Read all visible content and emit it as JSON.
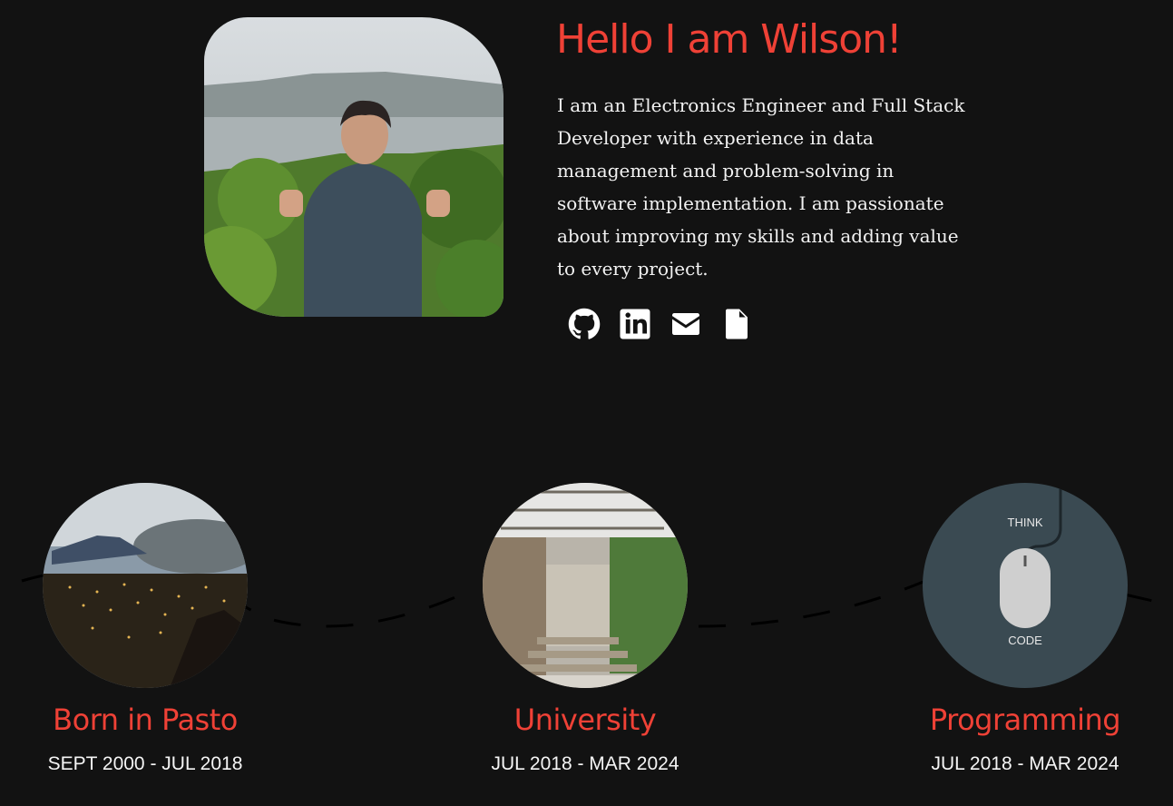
{
  "hero": {
    "title": "Hello I am Wilson!",
    "bio": "I am an Electronics Engineer and Full Stack Developer with experience in data management and problem-solving in software implementation. I am passionate about improving my skills and adding value to every project."
  },
  "social": [
    {
      "icon": "github-icon"
    },
    {
      "icon": "linkedin-icon"
    },
    {
      "icon": "envelope-icon"
    },
    {
      "icon": "document-icon"
    }
  ],
  "timeline": [
    {
      "title": "Born in Pasto",
      "date": "SEPT 2000 - JUL 2018"
    },
    {
      "title": "University",
      "date": "JUL 2018 - MAR 2024"
    },
    {
      "title": "Programming",
      "date": "JUL 2018 - MAR 2024",
      "image_text": {
        "top": "THINK",
        "bottom": "CODE"
      }
    }
  ],
  "colors": {
    "accent": "#ef4136",
    "background": "#121212",
    "text": "#f2f2f2"
  }
}
